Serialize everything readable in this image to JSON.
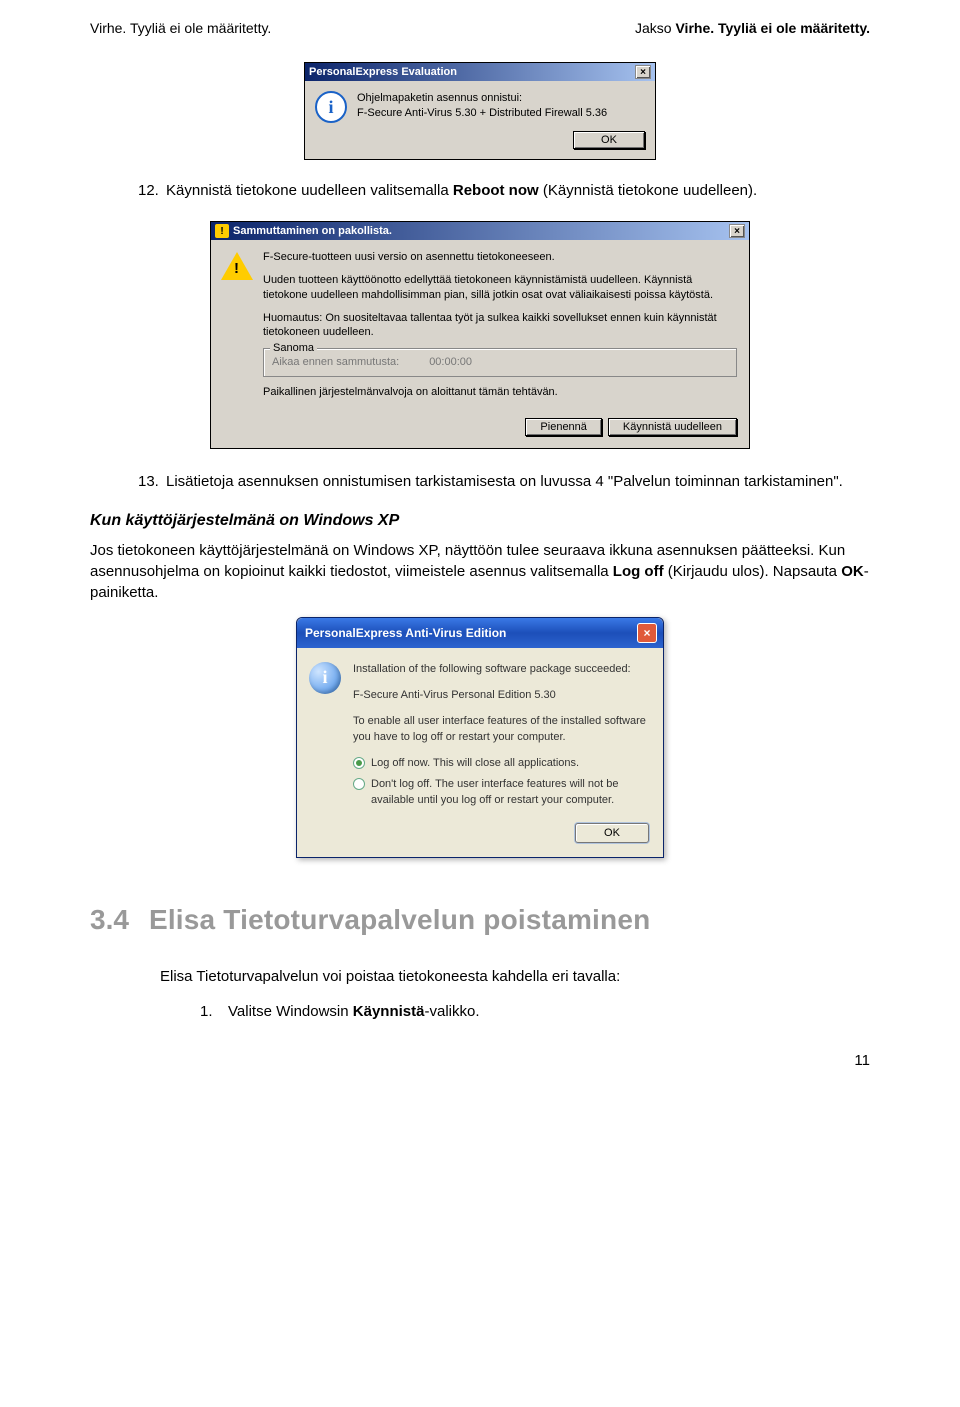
{
  "header": {
    "left": "Virhe. Tyyliä ei ole määritetty.",
    "right_prefix": "Jakso ",
    "right_bold": "Virhe. Tyyliä ei ole määritetty."
  },
  "dialog1": {
    "title": "PersonalExpress Evaluation",
    "line1": "Ohjelmapaketin asennus onnistui:",
    "line2": "F-Secure Anti-Virus 5.30 + Distributed Firewall 5.36",
    "ok": "OK"
  },
  "list": {
    "item12_num": "12.",
    "item12_pre": "Käynnistä tietokone uudelleen valitsemalla ",
    "item12_bold": "Reboot now",
    "item12_post": " (Käynnistä tietokone uudelleen).",
    "item13_num": "13.",
    "item13_text": "Lisätietoja asennuksen onnistumisen tarkistamisesta on luvussa 4 \"Palvelun toiminnan tarkistaminen\"."
  },
  "dialog2": {
    "title": "Sammuttaminen on pakollista.",
    "p1": "F-Secure-tuotteen uusi versio on asennettu tietokoneeseen.",
    "p2": "Uuden tuotteen käyttöönotto edellyttää tietokoneen käynnistämistä uudelleen. Käynnistä tietokone uudelleen mahdollisimman pian, sillä jotkin osat ovat väliaikaisesti poissa käytöstä.",
    "p3": "Huomautus: On suositeltavaa tallentaa työt ja sulkea kaikki sovellukset ennen kuin käynnistät tietokoneen uudelleen.",
    "fieldset_legend": "Sanoma",
    "timer_label": "Aikaa ennen sammutusta:",
    "timer_value": "00:00:00",
    "p4": "Paikallinen järjestelmänvalvoja on aloittanut tämän tehtävän.",
    "btn1": "Pienennä",
    "btn2": "Käynnistä uudelleen"
  },
  "xp_section": {
    "subhead": "Kun käyttöjärjestelmänä on Windows XP",
    "para_pre": "Jos tietokoneen käyttöjärjestelmänä on Windows XP, näyttöön tulee seuraava ikkuna asennuksen päätteeksi. Kun asennusohjelma on kopioinut kaikki tiedostot, viimeistele asennus valitsemalla ",
    "para_bold1": "Log off",
    "para_mid": " (Kirjaudu ulos). Napsauta ",
    "para_bold2": "OK",
    "para_post": "-painiketta."
  },
  "dialog3": {
    "title": "PersonalExpress Anti-Virus Edition",
    "p1": "Installation of the following software package succeeded:",
    "p2": "F-Secure Anti-Virus Personal Edition 5.30",
    "p3": "To enable all user interface features of the installed software you have to log off or restart your computer.",
    "opt1": "Log off now. This will close all applications.",
    "opt2": "Don't log off. The user interface features will not be available until you log off or restart your computer.",
    "ok": "OK"
  },
  "section34": {
    "num": "3.4",
    "title": "Elisa Tietoturvapalvelun poistaminen",
    "intro": "Elisa Tietoturvapalvelun voi poistaa tietokoneesta kahdella eri tavalla:",
    "step_num": "1.",
    "step_pre": "Valitse Windowsin ",
    "step_bold": "Käynnistä",
    "step_post": "-valikko."
  },
  "page_num": "11"
}
